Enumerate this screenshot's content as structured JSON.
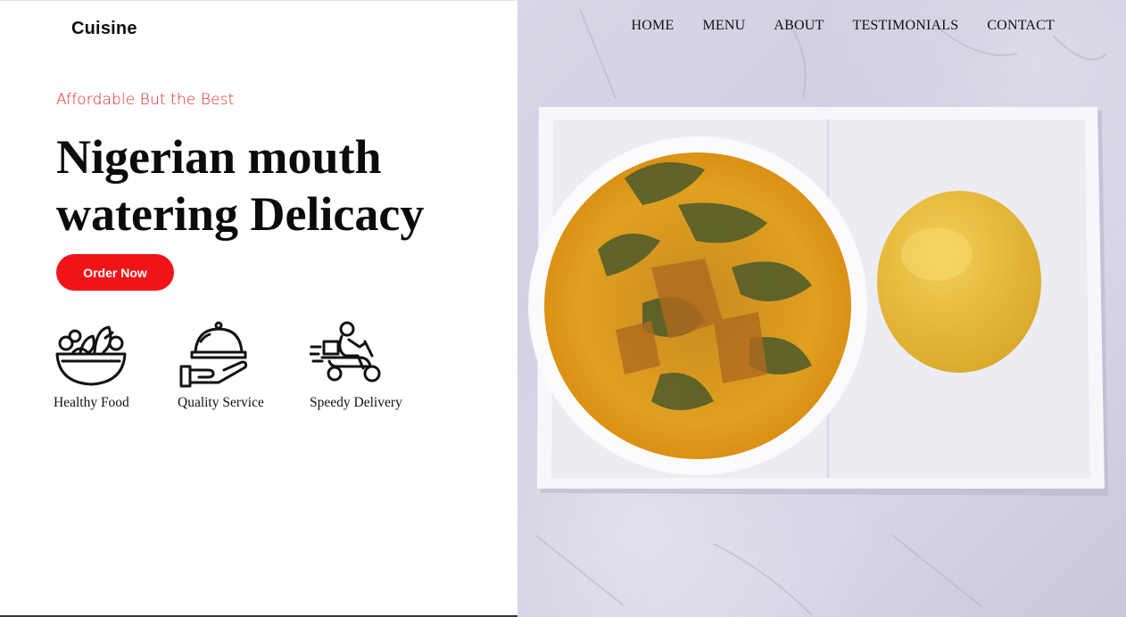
{
  "brand": {
    "name": "Cuisine"
  },
  "nav": {
    "items": [
      "HOME",
      "MENU",
      "ABOUT",
      "TESTIMONIALS",
      "CONTACT"
    ]
  },
  "hero": {
    "tagline": "Affordable But the Best",
    "title": "Nigerian mouth watering Delicacy",
    "cta_label": "Order Now"
  },
  "features": [
    {
      "label": "Healthy Food",
      "icon": "salad-bowl-icon"
    },
    {
      "label": "Quality Service",
      "icon": "serving-dish-hand-icon"
    },
    {
      "label": "Speedy Delivery",
      "icon": "delivery-scooter-icon"
    }
  ],
  "colors": {
    "accent": "#f01418",
    "tagline": "#e3262b",
    "text": "#111111",
    "background": "#ffffff"
  },
  "image": {
    "icon": "food-photo-soup-and-swallow"
  }
}
